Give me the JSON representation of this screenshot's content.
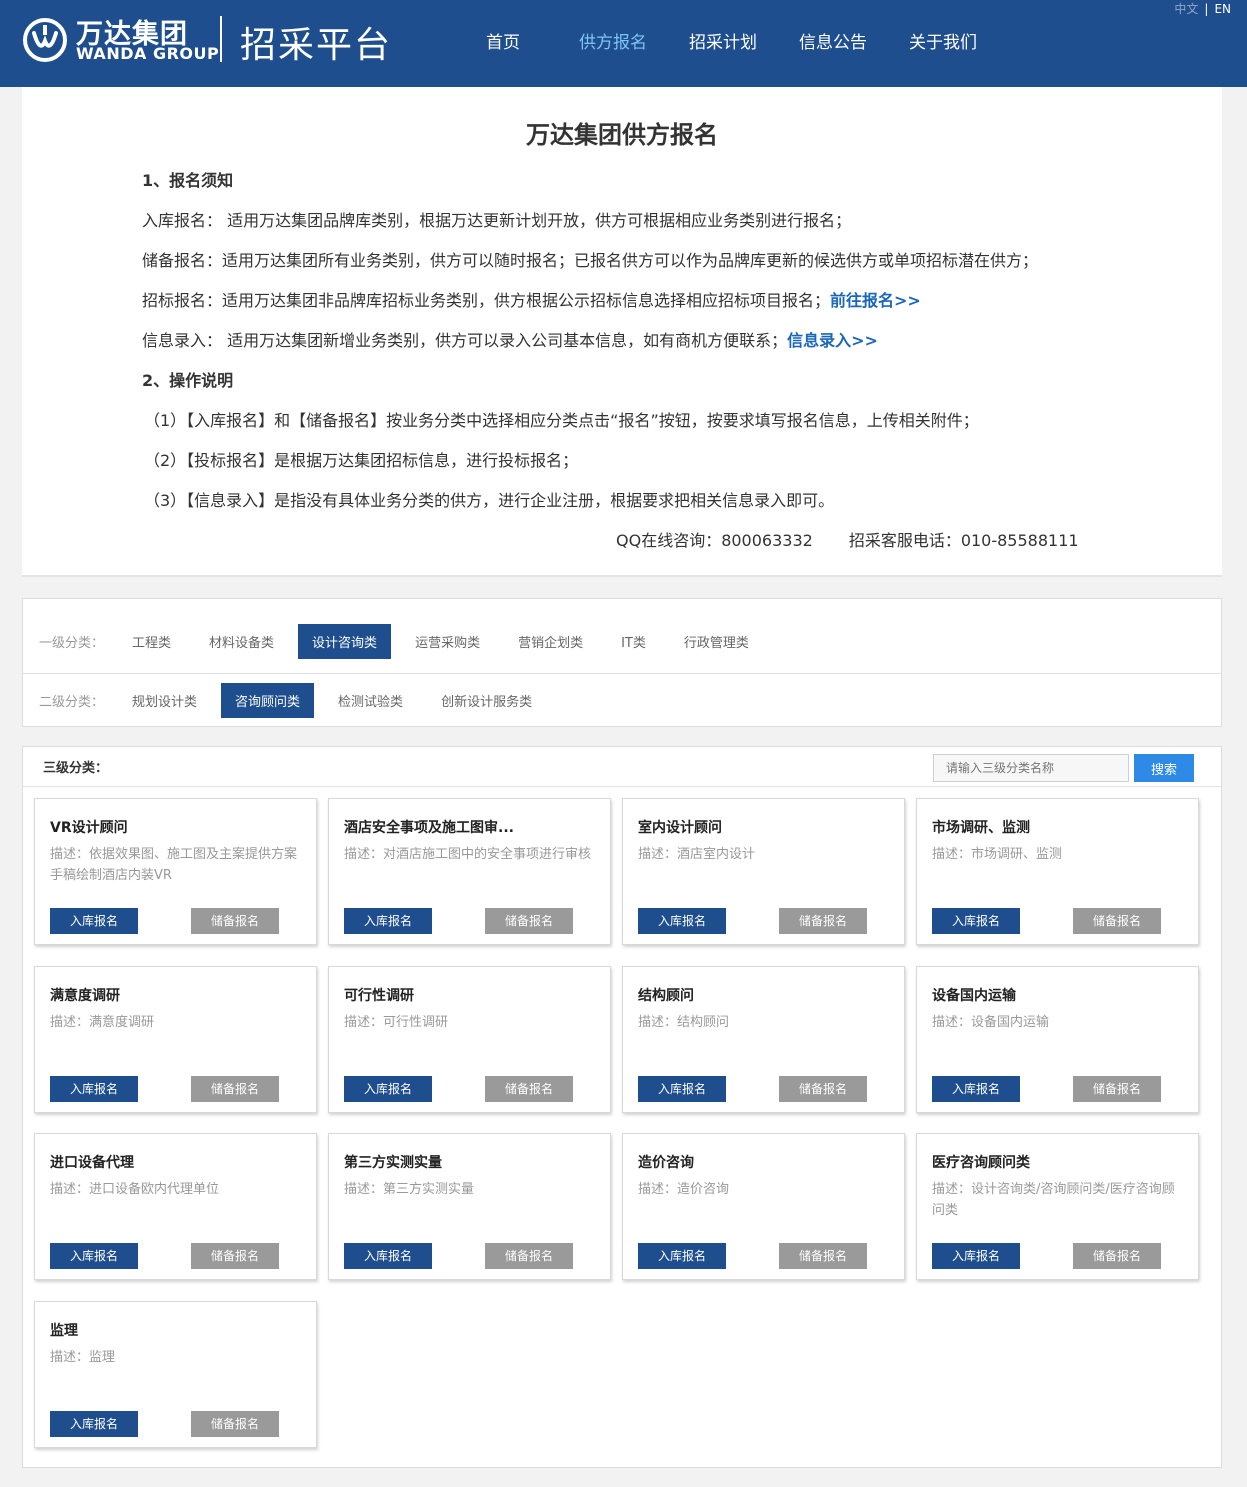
{
  "header": {
    "logo_cn": "万达集团",
    "logo_en": "WANDA GROUP",
    "platform_title": "招采平台",
    "nav": [
      {
        "label": "首页",
        "active": false
      },
      {
        "label": "供方报名",
        "active": true
      },
      {
        "label": "招采计划",
        "active": false
      },
      {
        "label": "信息公告",
        "active": false
      },
      {
        "label": "关于我们",
        "active": false
      }
    ],
    "lang_zh": "中文",
    "lang_sep": "|",
    "lang_en": "EN"
  },
  "notice": {
    "title": "万达集团供方报名",
    "section1_heading": "1、报名须知",
    "line_ruku": "入库报名： 适用万达集团品牌库类别，根据万达更新计划开放，供方可根据相应业务类别进行报名；",
    "line_chubei": "储备报名：适用万达集团所有业务类别，供方可以随时报名；已报名供方可以作为品牌库更新的候选供方或单项招标潜在供方；",
    "line_zhaobiao": "招标报名：适用万达集团非品牌库招标业务类别，供方根据公示招标信息选择相应招标项目报名；",
    "link_zhaobiao": "前往报名>>",
    "line_xinxi": "信息录入： 适用万达集团新增业务类别，供方可以录入公司基本信息，如有商机方便联系；",
    "link_xinxi": "信息录入>>",
    "section2_heading": "2、操作说明",
    "step1": "（1）【入库报名】和【储备报名】按业务分类中选择相应分类点击“报名”按钮，按要求填写报名信息，上传相关附件；",
    "step2": "（2）【投标报名】是根据万达集团招标信息，进行投标报名；",
    "step3": "（3）【信息录入】是指没有具体业务分类的供方，进行企业注册，根据要求把相关信息录入即可。",
    "qq": "QQ在线咨询：800063332",
    "phone": "招采客服电话：010-85588111"
  },
  "filter": {
    "level1_label": "一级分类：",
    "level1_items": [
      {
        "label": "工程类",
        "active": false
      },
      {
        "label": "材料设备类",
        "active": false
      },
      {
        "label": "设计咨询类",
        "active": true
      },
      {
        "label": "运营采购类",
        "active": false
      },
      {
        "label": "营销企划类",
        "active": false
      },
      {
        "label": "IT类",
        "active": false
      },
      {
        "label": "行政管理类",
        "active": false
      }
    ],
    "level2_label": "二级分类：",
    "level2_items": [
      {
        "label": "规划设计类",
        "active": false
      },
      {
        "label": "咨询顾问类",
        "active": true
      },
      {
        "label": "检测试验类",
        "active": false
      },
      {
        "label": "创新设计服务类",
        "active": false
      }
    ]
  },
  "level3": {
    "label": "三级分类：",
    "search_placeholder": "请输入三级分类名称",
    "search_button": "搜索",
    "btn_ruku": "入库报名",
    "btn_chubei": "储备报名",
    "cards": [
      {
        "title": "VR设计顾问",
        "desc": "描述：依据效果图、施工图及主案提供方案手稿绘制酒店内装VR"
      },
      {
        "title": "酒店安全事项及施工图审...",
        "desc": "描述：对酒店施工图中的安全事项进行审核"
      },
      {
        "title": "室内设计顾问",
        "desc": "描述：酒店室内设计"
      },
      {
        "title": "市场调研、监测",
        "desc": "描述：市场调研、监测"
      },
      {
        "title": "满意度调研",
        "desc": "描述：满意度调研"
      },
      {
        "title": "可行性调研",
        "desc": "描述：可行性调研"
      },
      {
        "title": "结构顾问",
        "desc": "描述：结构顾问"
      },
      {
        "title": "设备国内运输",
        "desc": "描述：设备国内运输"
      },
      {
        "title": "进口设备代理",
        "desc": "描述：进口设备欧内代理单位"
      },
      {
        "title": "第三方实测实量",
        "desc": "描述：第三方实测实量"
      },
      {
        "title": "造价咨询",
        "desc": "描述：造价咨询"
      },
      {
        "title": "医疗咨询顾问类",
        "desc": "描述：设计咨询类/咨询顾问类/医疗咨询顾问类"
      },
      {
        "title": "监理",
        "desc": "描述：监理"
      }
    ]
  },
  "colors": {
    "brand_blue": "#1f4e8f",
    "nav_active": "#7ec4f4",
    "link_blue": "#1a66b8",
    "search_blue": "#2e8ae6"
  }
}
